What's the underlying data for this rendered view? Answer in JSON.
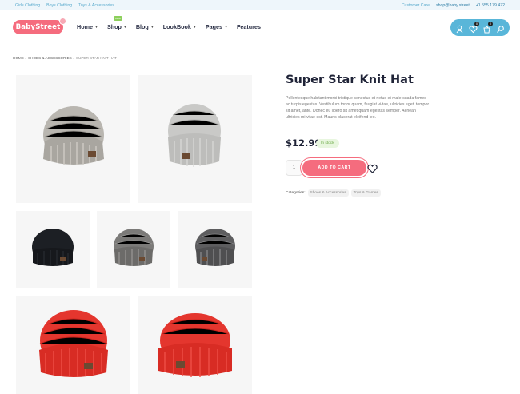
{
  "topbar": {
    "links": [
      "Girls Clothing",
      "Boys Clothing",
      "Toys & Accessories"
    ],
    "customer_care_label": "Customer Care",
    "email": "shop@baby.street",
    "phone": "+1 555 179 472"
  },
  "header": {
    "logo_text": "BabyStreet",
    "nav": [
      {
        "label": "Home",
        "dropdown": true
      },
      {
        "label": "Shop",
        "dropdown": true,
        "badge": "new"
      },
      {
        "label": "Blog",
        "dropdown": true
      },
      {
        "label": "LookBook",
        "dropdown": true
      },
      {
        "label": "Pages",
        "dropdown": true
      },
      {
        "label": "Features",
        "dropdown": false
      }
    ],
    "icons": [
      "user-icon",
      "heart-icon",
      "cart-icon",
      "search-icon"
    ],
    "wishlist_count": "0",
    "cart_count": "0"
  },
  "breadcrumb": {
    "home": "HOME",
    "category": "SHOES & ACCESSORIES",
    "separator": "/",
    "current": "SUPER STAR KNIT HAT"
  },
  "gallery": {
    "images": [
      {
        "hat": "grey-beanie"
      },
      {
        "hat": "light-grey-beanie"
      },
      {
        "hat": "black-beanie"
      },
      {
        "hat": "dark-grey-beanie"
      },
      {
        "hat": "charcoal-mix-beanie"
      },
      {
        "hat": "red-beanie"
      },
      {
        "hat": "red-beanie"
      }
    ],
    "colors": {
      "grey": "#b9b6b0",
      "light_grey": "#c9c9c7",
      "black": "#1c1f24",
      "dark_grey": "#7b7a78",
      "charcoal": "#5d5d5f",
      "red": "#e4362e",
      "tile_bg": "#f6f6f6"
    }
  },
  "product": {
    "title": "Super Star Knit Hat",
    "description": "Pellentesque habitant morbi tristique senectus et netus et male-suada fames ac turpis egestas. Vestibulum tortor quam, feugiat vi-tae, ultricies eget, tempor sit amet, ante. Donec eu libero sit amet quam egestas semper. Aenean ultricies mi vitae est. Mauris placerat eleifend leo.",
    "price": "$12.99",
    "stock": "In stock",
    "quantity": "1",
    "add_to_cart": "ADD TO CART",
    "categories_label": "Categories:",
    "categories": [
      "Shoes & Accessories",
      "Toys & Games"
    ]
  },
  "colors": {
    "accent": "#f56c7e",
    "blue": "#59b6d9",
    "stock_green": "#6dab48"
  }
}
